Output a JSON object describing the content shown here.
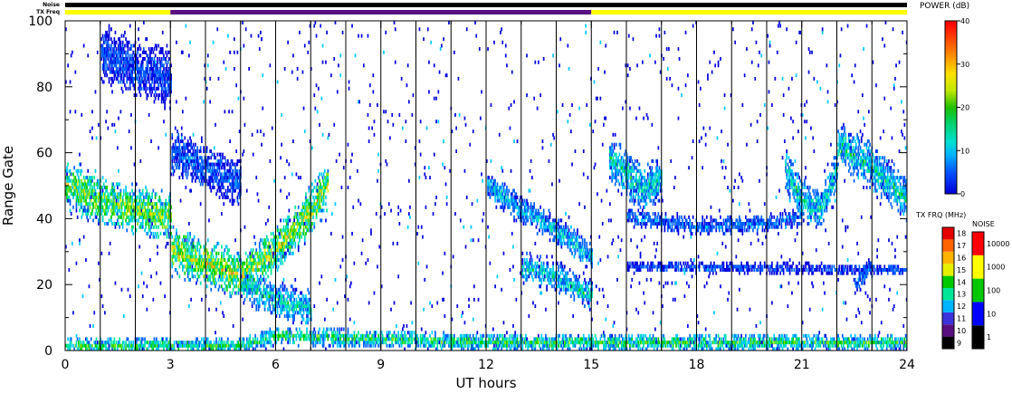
{
  "header": {
    "noise_label": "Noise",
    "txfreq_label": "TX Freq",
    "noise_bar_color": "#000000",
    "txfreq_segments": [
      {
        "from": 0,
        "to": 3,
        "color": "#ffff00"
      },
      {
        "from": 3,
        "to": 15,
        "color": "#5a0f80"
      },
      {
        "from": 15,
        "to": 24,
        "color": "#ffff00"
      }
    ]
  },
  "chart_data": {
    "type": "heatmap",
    "xlabel": "UT hours",
    "ylabel": "Range Gate",
    "xlim": [
      0,
      24
    ],
    "ylim": [
      0,
      100
    ],
    "xticks": [
      0,
      3,
      6,
      9,
      12,
      15,
      18,
      21,
      24
    ],
    "yticks": [
      0,
      20,
      40,
      60,
      80,
      100
    ],
    "scan_boundaries_hours": [
      1,
      2,
      3,
      4,
      5,
      6,
      7,
      8,
      9,
      10,
      11,
      12,
      13,
      14,
      15,
      16,
      17,
      18,
      19,
      20,
      21,
      22,
      23
    ],
    "power_scale": {
      "title": "POWER (dB)",
      "min": 0,
      "max": 40,
      "ticks": [
        0,
        10,
        20,
        30,
        40
      ],
      "colors": [
        "#0000e0",
        "#0060ff",
        "#00c8ff",
        "#00e6a0",
        "#00d000",
        "#80e000",
        "#e0f000",
        "#ffc800",
        "#ff7800",
        "#ff0000"
      ]
    },
    "txfreq_scale": {
      "title": "TX FRQ (MHz)",
      "levels": [
        9,
        10,
        11,
        12,
        13,
        14,
        15,
        16,
        17,
        18
      ],
      "colors": [
        "#000000",
        "#5a0f80",
        "#3c32dc",
        "#00b4ff",
        "#00e696",
        "#00c800",
        "#e6f000",
        "#ffb400",
        "#ff6400",
        "#e60000"
      ]
    },
    "noise_scale": {
      "title": "NOISE",
      "levels": [
        1,
        10,
        100,
        1000,
        10000
      ],
      "colors": [
        "#000000",
        "#0000ff",
        "#00c800",
        "#ffff00",
        "#ff0000"
      ]
    },
    "echo_bands": [
      {
        "name": "ground-scatter-near",
        "points": [
          [
            0.0,
            1
          ],
          [
            3.0,
            1
          ],
          [
            5.0,
            1
          ],
          [
            6.0,
            4
          ],
          [
            9.0,
            3
          ],
          [
            12.0,
            2
          ],
          [
            15.0,
            2
          ],
          [
            24.0,
            2
          ]
        ],
        "width": 3,
        "power": 18
      },
      {
        "name": "band-a",
        "points": [
          [
            0.0,
            50
          ],
          [
            1.0,
            45
          ],
          [
            2.0,
            42
          ],
          [
            3.0,
            40
          ]
        ],
        "width": 8,
        "power": 24
      },
      {
        "name": "band-b",
        "points": [
          [
            3.0,
            30
          ],
          [
            4.0,
            26
          ],
          [
            5.0,
            22
          ],
          [
            6.0,
            30
          ],
          [
            7.0,
            42
          ],
          [
            7.5,
            50
          ]
        ],
        "width": 8,
        "power": 26
      },
      {
        "name": "band-c",
        "points": [
          [
            5.0,
            20
          ],
          [
            6.0,
            15
          ],
          [
            7.0,
            12
          ]
        ],
        "width": 6,
        "power": 14
      },
      {
        "name": "band-d",
        "points": [
          [
            12.0,
            50
          ],
          [
            13.0,
            42
          ],
          [
            14.0,
            36
          ],
          [
            15.0,
            28
          ]
        ],
        "width": 5,
        "power": 12
      },
      {
        "name": "band-e",
        "points": [
          [
            13.0,
            25
          ],
          [
            14.0,
            22
          ],
          [
            15.0,
            16
          ]
        ],
        "width": 5,
        "power": 14
      },
      {
        "name": "band-f",
        "points": [
          [
            15.5,
            58
          ],
          [
            16.5,
            48
          ],
          [
            17.0,
            52
          ]
        ],
        "width": 8,
        "power": 14
      },
      {
        "name": "band-g",
        "points": [
          [
            16.0,
            40
          ],
          [
            18.0,
            37
          ],
          [
            20.0,
            38
          ],
          [
            21.0,
            40
          ]
        ],
        "width": 3,
        "power": 8
      },
      {
        "name": "band-h",
        "points": [
          [
            16.0,
            25
          ],
          [
            24.0,
            24
          ]
        ],
        "width": 2,
        "power": 6
      },
      {
        "name": "band-i",
        "points": [
          [
            20.5,
            55
          ],
          [
            21.0,
            45
          ],
          [
            21.5,
            42
          ],
          [
            22.0,
            55
          ]
        ],
        "width": 7,
        "power": 14
      },
      {
        "name": "band-j",
        "points": [
          [
            22.0,
            62
          ],
          [
            23.0,
            55
          ],
          [
            24.0,
            45
          ]
        ],
        "width": 8,
        "power": 14
      },
      {
        "name": "band-k",
        "points": [
          [
            1.0,
            90
          ],
          [
            2.0,
            85
          ],
          [
            3.0,
            82
          ]
        ],
        "width": 10,
        "power": 6
      },
      {
        "name": "band-l",
        "points": [
          [
            3.0,
            60
          ],
          [
            4.0,
            55
          ],
          [
            5.0,
            50
          ]
        ],
        "width": 8,
        "power": 7
      },
      {
        "name": "band-m",
        "points": [
          [
            22.5,
            20
          ],
          [
            23.0,
            25
          ]
        ],
        "width": 4,
        "power": 8
      }
    ]
  }
}
